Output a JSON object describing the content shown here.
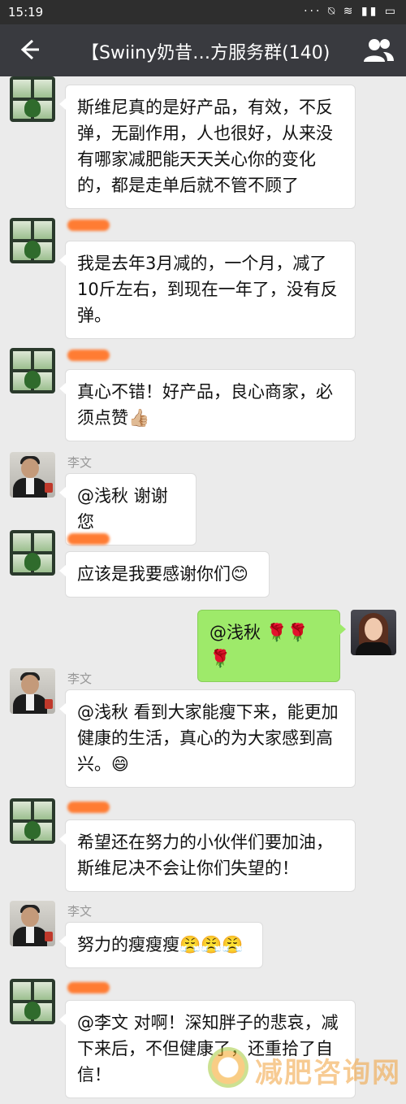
{
  "status_bar": {
    "time": "15:19",
    "icons": "··· ⍉ ≋ ▮▮ ▭"
  },
  "header": {
    "title": "【Swiiny奶昔…方服务群(140)",
    "back_icon": "back-arrow-icon",
    "group_icon": "group-members-icon"
  },
  "messages": [
    {
      "sender": "",
      "text": "斯维尼真的是好产品，有效，不反弹，无副作用，人也很好，从来没有哪家减肥能天天关心你的变化的，都是走单后就不管不顾了"
    },
    {
      "sender": "",
      "text": "我是去年3月减的，一个月，减了10斤左右，到现在一年了，没有反弹。"
    },
    {
      "sender": "",
      "text": "真心不错！好产品，良心商家，必须点赞👍🏼"
    },
    {
      "sender": "李文",
      "text": "@浅秋 谢谢您"
    },
    {
      "sender": "",
      "text": "应该是我要感谢你们😊"
    },
    {
      "sender": "",
      "text": "@浅秋 🌹🌹🌹"
    },
    {
      "sender": "李文",
      "text": "@浅秋 看到大家能瘦下来，能更加健康的生活，真心的为大家感到高兴。😄"
    },
    {
      "sender": "",
      "text": "希望还在努力的小伙伴们要加油，斯维尼决不会让你们失望的！"
    },
    {
      "sender": "李文",
      "text": "努力的瘦瘦瘦😤😤😤"
    },
    {
      "sender": "",
      "text": "@李文 对啊！深知胖子的悲哀，减下来后，不但健康了，还重拾了自信！"
    }
  ],
  "watermark": {
    "text": "减肥咨询网"
  },
  "colors": {
    "title_bar": "#393a3f",
    "status_bar": "#2e2e2e",
    "self_bubble": "#9eea6a",
    "chat_bg": "#ebebeb",
    "redacted_name": "#ff7c33"
  }
}
